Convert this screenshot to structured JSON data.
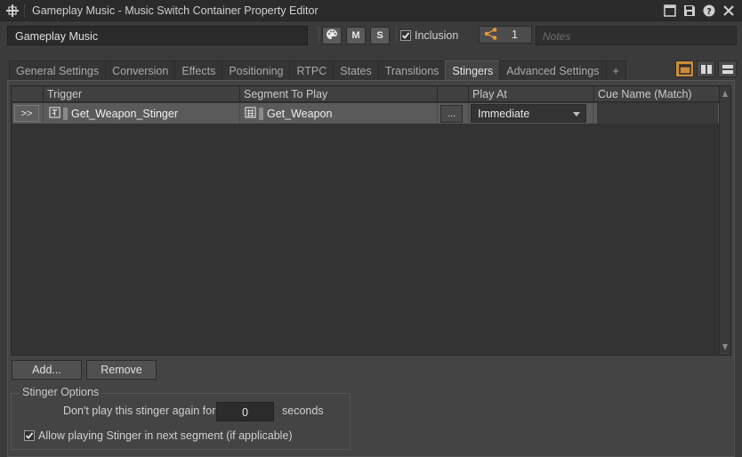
{
  "window": {
    "title": "Gameplay Music - Music Switch Container Property Editor",
    "icons": [
      "app-icon",
      "minimize-icon",
      "save-icon",
      "help-icon",
      "close-icon"
    ]
  },
  "header": {
    "object_name": "Gameplay Music",
    "palette_icon": "palette-icon",
    "mute_label": "M",
    "solo_label": "S",
    "inclusion_label": "Inclusion",
    "inclusion_checked": true,
    "share_icon": "share-icon",
    "share_count": "1",
    "notes_placeholder": "Notes"
  },
  "tabs": [
    {
      "label": "General Settings",
      "active": false
    },
    {
      "label": "Conversion",
      "active": false
    },
    {
      "label": "Effects",
      "active": false
    },
    {
      "label": "Positioning",
      "active": false
    },
    {
      "label": "RTPC",
      "active": false
    },
    {
      "label": "States",
      "active": false
    },
    {
      "label": "Transitions",
      "active": false
    },
    {
      "label": "Stingers",
      "active": true
    },
    {
      "label": "Advanced Settings",
      "active": false
    },
    {
      "label": "+",
      "active": false
    }
  ],
  "view_buttons": [
    "layout-single-icon",
    "layout-split-vertical-icon",
    "layout-split-horizontal-icon"
  ],
  "stingers": {
    "columns": [
      "",
      "Trigger",
      "Segment To Play",
      "",
      "Play At",
      "Cue Name (Match)"
    ],
    "rows": [
      {
        "expand_label": ">>",
        "trigger": "Get_Weapon_Stinger",
        "trigger_icon": "trigger-icon",
        "segment": "Get_Weapon",
        "segment_icon": "music-segment-icon",
        "browse_label": "...",
        "play_at": "Immediate",
        "cue_name": ""
      }
    ],
    "add_label": "Add...",
    "remove_label": "Remove"
  },
  "options": {
    "title": "Stinger Options",
    "dont_play_label": "Don't play this stinger again for",
    "dont_play_value": "0",
    "unit_label": "seconds",
    "allow_label": "Allow playing Stinger in next segment (if applicable)",
    "allow_checked": true
  },
  "colors": {
    "accent": "#cb8c3a",
    "background": "#3b3b3b",
    "panel": "#444444",
    "selected_row": "#5a5a5a"
  }
}
